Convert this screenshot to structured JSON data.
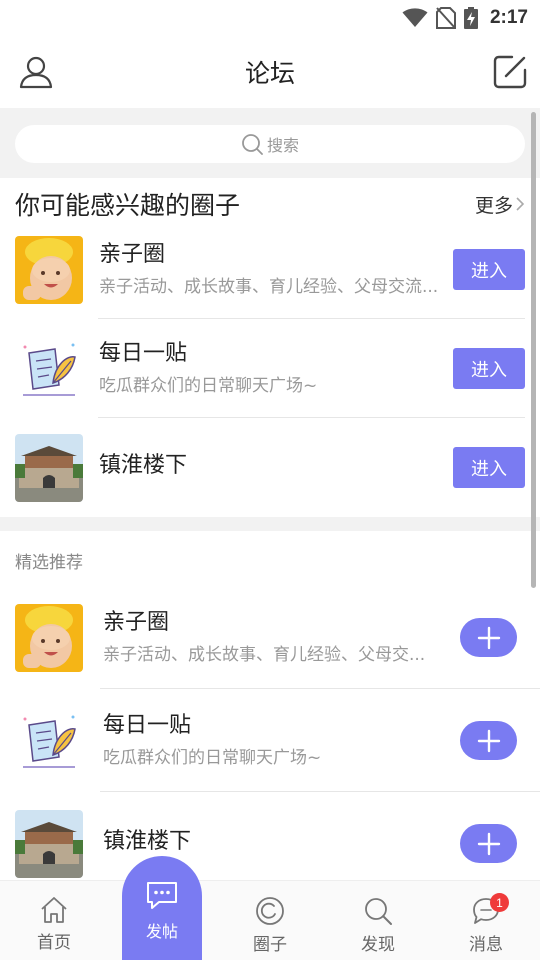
{
  "status_bar": {
    "time": "2:17"
  },
  "header": {
    "title": "论坛"
  },
  "search": {
    "placeholder": "搜索"
  },
  "interest_section": {
    "title": "你可能感兴趣的圈子",
    "more_label": "更多",
    "items": [
      {
        "name": "亲子圈",
        "desc": "亲子活动、成长故事、育儿经验、父母交流...",
        "button": "进入"
      },
      {
        "name": "每日一贴",
        "desc": "吃瓜群众们的日常聊天广场~",
        "button": "进入"
      },
      {
        "name": "镇淮楼下",
        "desc": "",
        "button": "进入"
      }
    ]
  },
  "featured_section": {
    "label": "精选推荐",
    "items": [
      {
        "name": "亲子圈",
        "desc": "亲子活动、成长故事、育儿经验、父母交..."
      },
      {
        "name": "每日一贴",
        "desc": "吃瓜群众们的日常聊天广场~"
      },
      {
        "name": "镇淮楼下",
        "desc": ""
      }
    ]
  },
  "bottom_nav": {
    "home": "首页",
    "post": "发帖",
    "circles": "圈子",
    "discover": "发现",
    "messages": "消息",
    "message_badge": "1"
  },
  "colors": {
    "accent": "#7a7bf2",
    "badge": "#ef3a3a"
  }
}
